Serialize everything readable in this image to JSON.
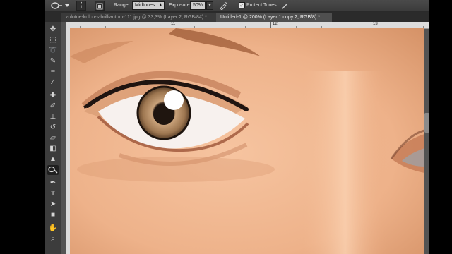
{
  "options_bar": {
    "brush_size": "1",
    "range_label": "Range:",
    "range_value": "Midtones",
    "exposure_label": "Exposure:",
    "exposure_value": "50%",
    "protect_tones_checked": "✓",
    "protect_tones_label": "Protect Tones"
  },
  "tabs": [
    {
      "label": "zolotoe-kolco-s-brilliantom-111.jpg @ 33,3% (Layer 2, RGB/8#) *",
      "active": false
    },
    {
      "label": "Untitled-1 @ 200% (Layer 1 copy 2, RGB/8) *",
      "active": true
    }
  ],
  "ruler": {
    "labels": [
      "11",
      "12",
      "13"
    ]
  },
  "toolbox": {
    "tools": [
      "move-tool",
      "marquee-tool",
      "lasso-tool",
      "quick-selection-tool",
      "crop-tool",
      "eyedropper-tool",
      "healing-brush-tool",
      "brush-tool",
      "clone-stamp-tool",
      "history-brush-tool",
      "eraser-tool",
      "gradient-tool",
      "blur-tool",
      "dodge-burn-tool",
      "pen-tool",
      "type-tool",
      "path-selection-tool",
      "rectangle-tool",
      "hand-tool",
      "zoom-tool"
    ],
    "active": "dodge-burn-tool"
  },
  "colors": {
    "skin": "#efb68e",
    "iris": "#a87a4e",
    "ui_dark": "#3c3c3c"
  }
}
